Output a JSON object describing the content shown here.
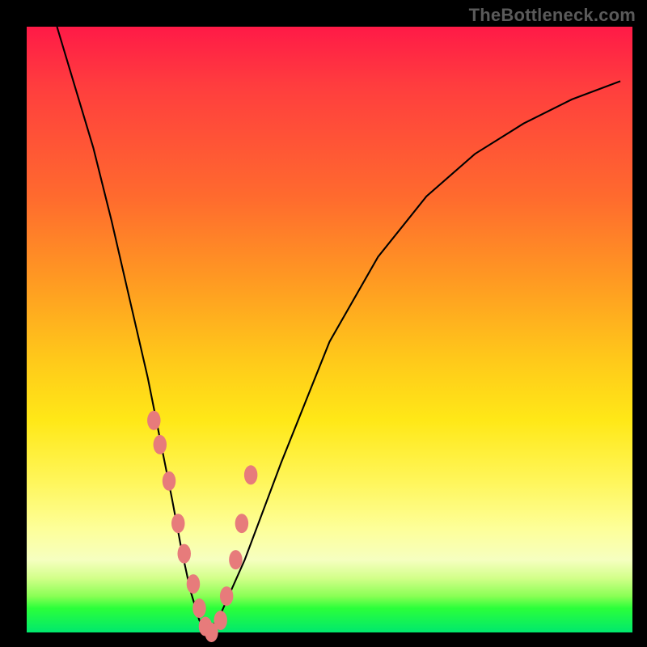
{
  "watermark": "TheBottleneck.com",
  "chart_data": {
    "type": "line",
    "title": "",
    "xlabel": "",
    "ylabel": "",
    "xlim": [
      0,
      100
    ],
    "ylim": [
      0,
      100
    ],
    "series": [
      {
        "name": "bottleneck-curve",
        "x": [
          5,
          8,
          11,
          14,
          17,
          20,
          22,
          24,
          25.5,
          27,
          28.5,
          30,
          32,
          36,
          42,
          50,
          58,
          66,
          74,
          82,
          90,
          98
        ],
        "y": [
          100,
          90,
          80,
          68,
          55,
          42,
          32,
          22,
          14,
          7,
          2,
          0,
          3,
          12,
          28,
          48,
          62,
          72,
          79,
          84,
          88,
          91
        ]
      }
    ],
    "markers": {
      "name": "highlight-dots",
      "color": "#e77b7b",
      "x": [
        21,
        22,
        23.5,
        25,
        26,
        27.5,
        28.5,
        29.5,
        30.5,
        32,
        33,
        34.5,
        35.5,
        37
      ],
      "y": [
        35,
        31,
        25,
        18,
        13,
        8,
        4,
        1,
        0,
        2,
        6,
        12,
        18,
        26
      ]
    }
  },
  "colors": {
    "gradient_top": "#ff1a47",
    "gradient_mid": "#ffe817",
    "gradient_bottom": "#00e86e",
    "curve": "#000000",
    "marker": "#e77b7b",
    "frame": "#000000"
  }
}
